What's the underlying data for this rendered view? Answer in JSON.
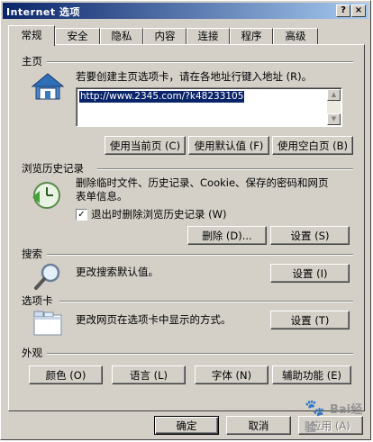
{
  "window": {
    "title": "Internet 选项",
    "help_glyph": "?",
    "close_glyph": "×"
  },
  "tabs": [
    {
      "label": "常规"
    },
    {
      "label": "安全"
    },
    {
      "label": "隐私"
    },
    {
      "label": "内容"
    },
    {
      "label": "连接"
    },
    {
      "label": "程序"
    },
    {
      "label": "高级"
    }
  ],
  "homepage": {
    "group_label": "主页",
    "instruction": "若要创建主页选项卡，请在各地址行键入地址 (R)。",
    "url_value": "http://www.2345.com/?k48233105",
    "use_current_button": "使用当前页 (C)",
    "use_default_button": "使用默认值 (F)",
    "use_blank_button": "使用空白页 (B)"
  },
  "history": {
    "group_label": "浏览历史记录",
    "description_line1": "删除临时文件、历史记录、Cookie、保存的密码和网页",
    "description_line2": "表单信息。",
    "checkbox_label": "退出时删除浏览历史记录 (W)",
    "checkbox_checked": true,
    "delete_button": "删除 (D)...",
    "settings_button": "设置 (S)"
  },
  "search": {
    "group_label": "搜索",
    "description": "更改搜索默认值。",
    "settings_button": "设置 (I)"
  },
  "tabs_section": {
    "group_label": "选项卡",
    "description": "更改网页在选项卡中显示的方式。",
    "settings_button": "设置 (T)"
  },
  "appearance": {
    "group_label": "外观",
    "colors_button": "颜色 (O)",
    "languages_button": "语言 (L)",
    "fonts_button": "字体 (N)",
    "accessibility_button": "辅助功能 (E)"
  },
  "footer": {
    "ok_button": "确定",
    "cancel_button": "取消",
    "apply_button": "应用 (A)"
  },
  "watermark": {
    "text": "Bai经验"
  },
  "colors": {
    "titlebar_start": "#0a246a",
    "titlebar_end": "#a6caf0",
    "face": "#d4d0c8",
    "selection": "#0a246a"
  }
}
